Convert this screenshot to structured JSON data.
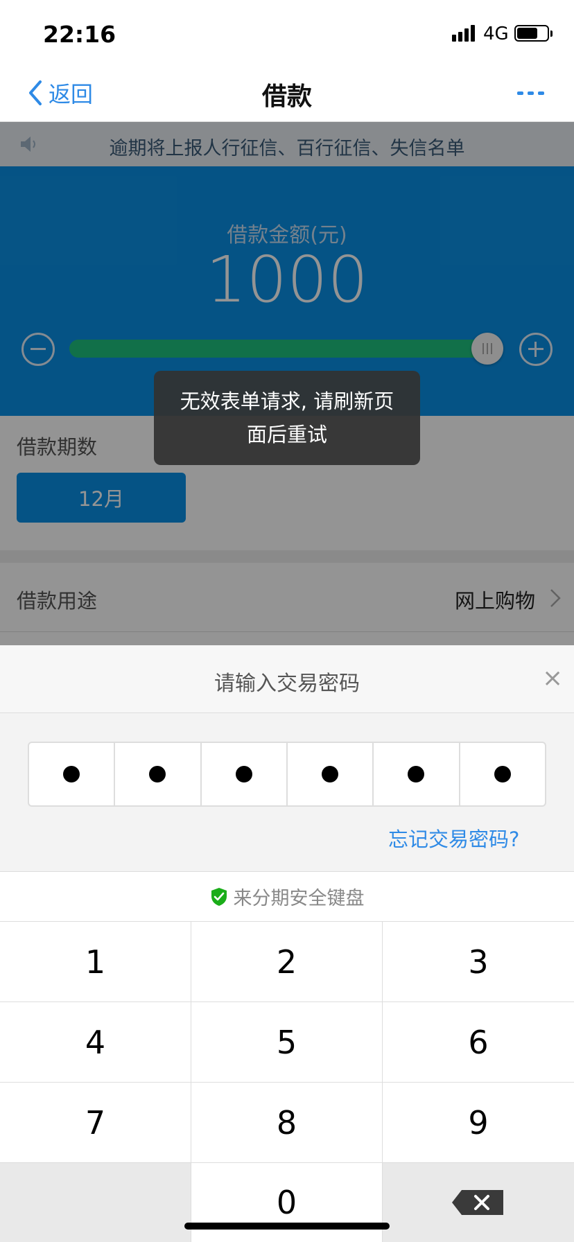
{
  "status_bar": {
    "time": "22:16",
    "network": "4G",
    "battery_level": 0.7
  },
  "nav": {
    "back_label": "返回",
    "title": "借款"
  },
  "notice": {
    "text": "逾期将上报人行征信、百行征信、失信名单"
  },
  "loan": {
    "amount_label": "借款金额(元)",
    "amount_value": "1000",
    "slider_level": 1.0,
    "period_label": "借款期数",
    "period_option": "12月",
    "purpose_label": "借款用途",
    "purpose_value": "网上购物"
  },
  "toast": {
    "line1": "无效表单请求, 请刷新页",
    "line2": "面后重试"
  },
  "password_sheet": {
    "title": "请输入交易密码",
    "entered_digits": 6,
    "forgot_label": "忘记交易密码?",
    "keyboard_title": "来分期安全键盘",
    "keys": [
      "1",
      "2",
      "3",
      "4",
      "5",
      "6",
      "7",
      "8",
      "9",
      "",
      "0",
      ""
    ]
  },
  "colors": {
    "brand_blue": "#0a90e6",
    "link_blue": "#2e8ae6",
    "slider_green": "#1ec27f",
    "shield_green": "#1aad19"
  }
}
